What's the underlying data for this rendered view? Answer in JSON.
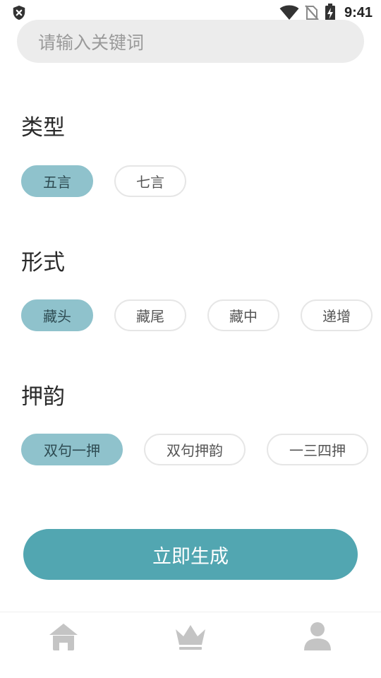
{
  "status_bar": {
    "time": "9:41",
    "icons": [
      "shield-x-icon",
      "wifi-icon",
      "no-sim-icon",
      "battery-charging-icon"
    ]
  },
  "search": {
    "placeholder": "请输入关键词",
    "value": ""
  },
  "sections": {
    "type": {
      "title": "类型",
      "options": [
        "五言",
        "七言"
      ],
      "selected": "五言"
    },
    "form": {
      "title": "形式",
      "options": [
        "藏头",
        "藏尾",
        "藏中",
        "递增"
      ],
      "selected": "藏头"
    },
    "rhyme": {
      "title": "押韵",
      "options": [
        "双句一押",
        "双句押韵",
        "一三四押"
      ],
      "selected": "双句一押"
    }
  },
  "generate_button": {
    "label": "立即生成"
  },
  "tab_bar": {
    "tabs": [
      {
        "icon": "home-icon"
      },
      {
        "icon": "crown-icon"
      },
      {
        "icon": "user-icon"
      }
    ]
  },
  "colors": {
    "accent": "#52a6b1",
    "chip_selected": "#8fc2cc",
    "chip_border": "#e6e6e6",
    "search_bg": "#ececec",
    "tab_icon": "#c4c4c4"
  }
}
